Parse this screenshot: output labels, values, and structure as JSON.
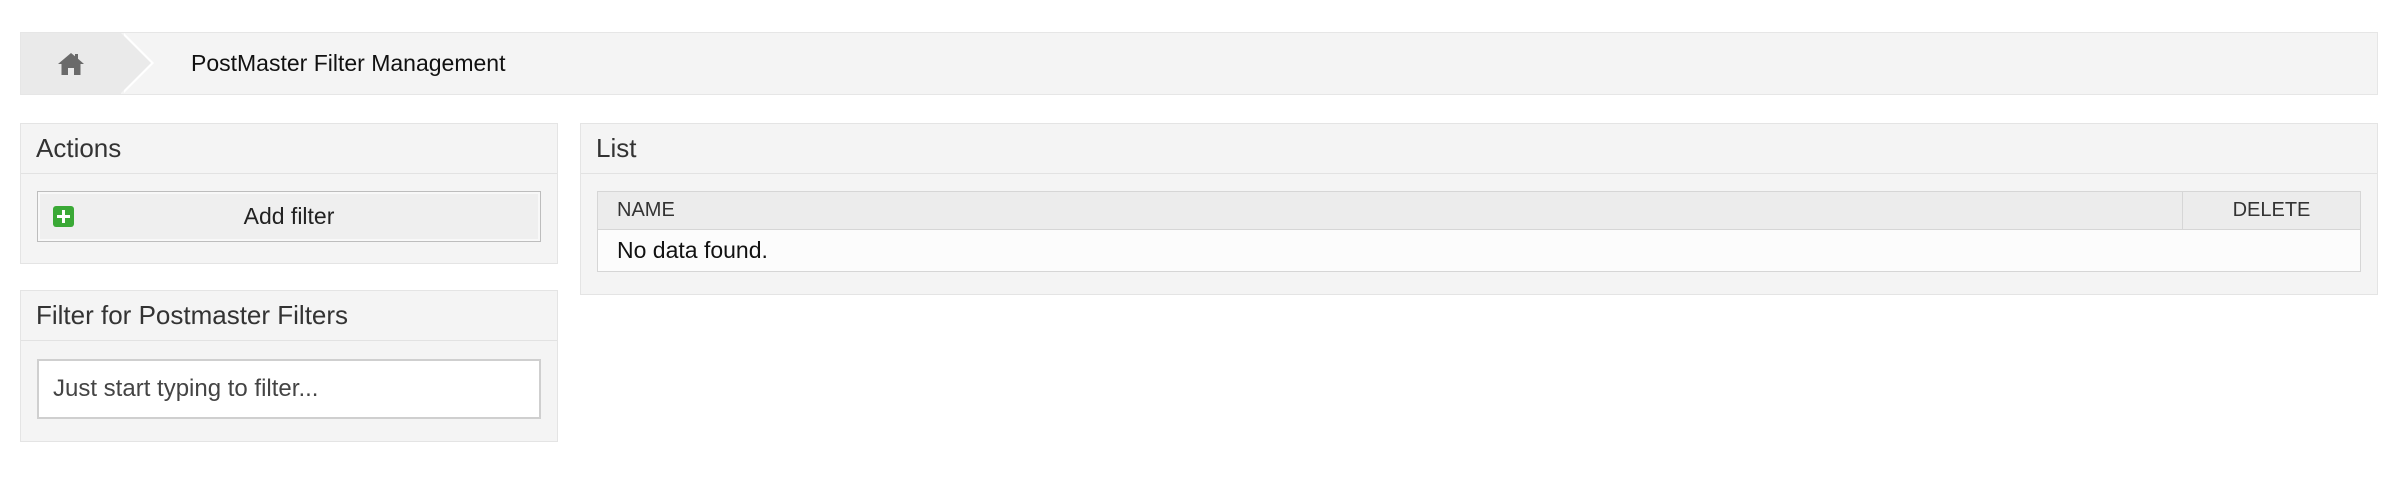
{
  "breadcrumb": {
    "home_icon": "home-icon",
    "title": "PostMaster Filter Management"
  },
  "actions": {
    "header": "Actions",
    "add_button": {
      "label": "Add filter",
      "icon": "plus-icon",
      "icon_color": "#3aa936"
    }
  },
  "filter_widget": {
    "header": "Filter for Postmaster Filters",
    "input": {
      "placeholder": "Just start typing to filter...",
      "value": ""
    }
  },
  "list": {
    "header": "List",
    "columns": [
      "NAME",
      "DELETE"
    ],
    "empty_text": "No data found."
  }
}
